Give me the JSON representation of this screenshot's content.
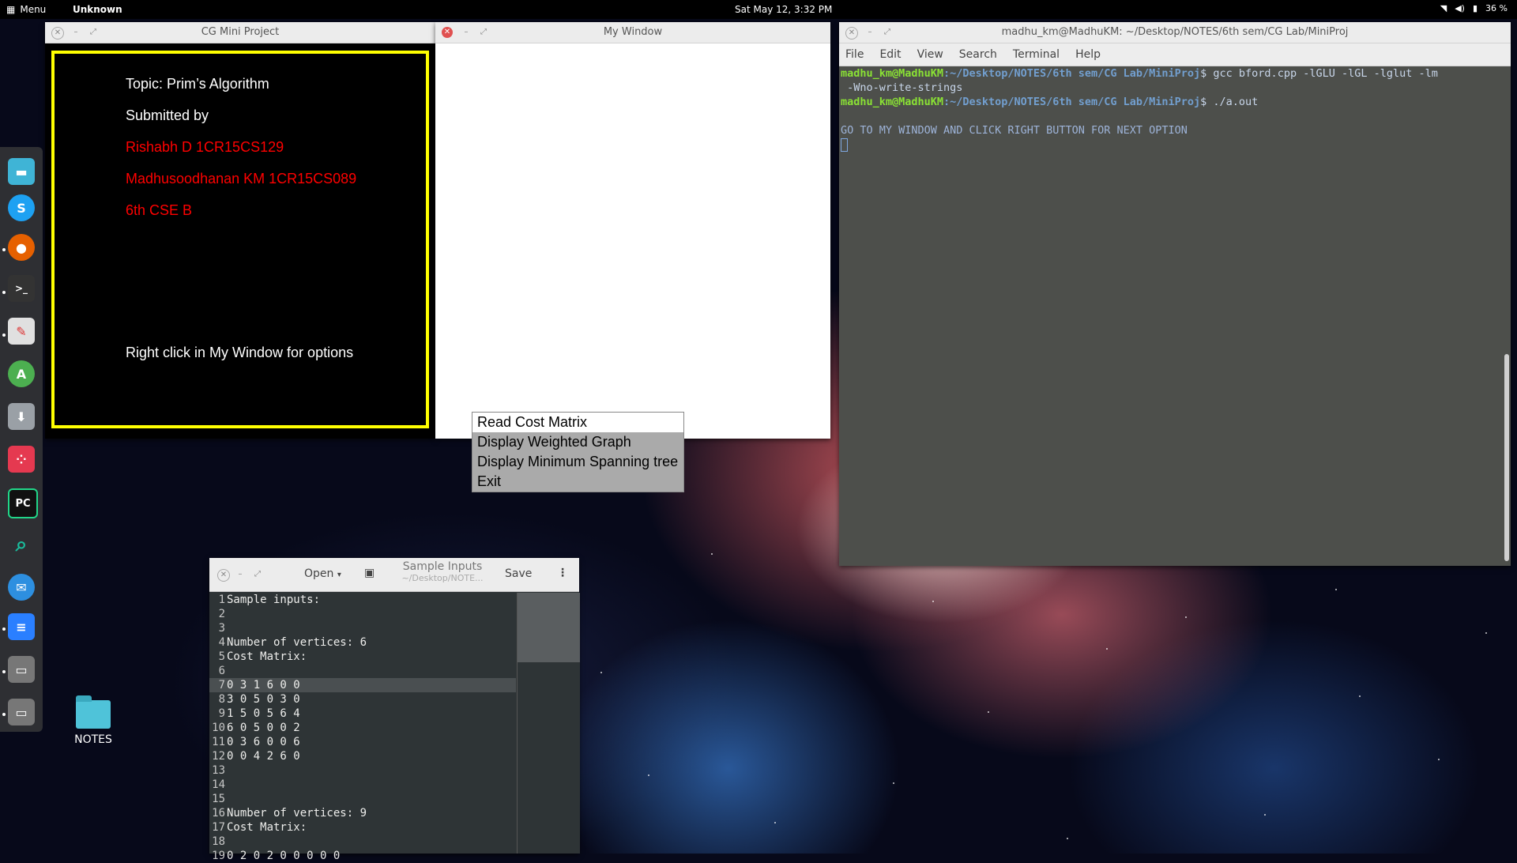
{
  "topbar": {
    "menu_label": "Menu",
    "app_label": "Unknown",
    "clock": "Sat May 12,  3:32 PM",
    "battery": "36 %"
  },
  "dock": {
    "items": [
      {
        "icon": "files-icon",
        "color": "#3fb4d6"
      },
      {
        "icon": "skype-icon",
        "color": "#1da1f2"
      },
      {
        "icon": "firefox-icon",
        "color": "#e66000"
      },
      {
        "icon": "terminal-icon",
        "color": "#333333"
      },
      {
        "icon": "text-editor-icon",
        "color": "#e0e0e0"
      },
      {
        "icon": "android-studio-icon",
        "color": "#4caf50"
      },
      {
        "icon": "software-center-icon",
        "color": "#9aa0a6"
      },
      {
        "icon": "app-icon",
        "color": "#e53950"
      },
      {
        "icon": "pycharm-icon",
        "color": "#21d789"
      },
      {
        "icon": "search-icon",
        "color": "#1abc9c"
      },
      {
        "icon": "thunderbird-icon",
        "color": "#2d8fe0"
      },
      {
        "icon": "document-icon",
        "color": "#2a7fff"
      },
      {
        "icon": "window-icon",
        "color": "#9a9a9a"
      },
      {
        "icon": "window-icon-2",
        "color": "#9a9a9a"
      }
    ]
  },
  "cg_window": {
    "title": "CG Mini Project",
    "topic": "Topic: Prim’s Algorithm",
    "submitted_by": "Submitted by",
    "student1": "Rishabh D  1CR15CS129",
    "student2": "Madhusoodhanan KM  1CR15CS089",
    "class": "6th CSE B",
    "hint": "Right click in My Window for options",
    "border_color": "#ffff00",
    "name_color": "#ff0000"
  },
  "my_window": {
    "title": "My Window"
  },
  "context_menu": {
    "items": [
      "Read Cost Matrix",
      "Display Weighted Graph",
      "Display Minimum Spanning tree",
      "Exit"
    ]
  },
  "terminal": {
    "title": "madhu_km@MadhuKM: ~/Desktop/NOTES/6th sem/CG Lab/MiniProj",
    "menu": [
      "File",
      "Edit",
      "View",
      "Search",
      "Terminal",
      "Help"
    ],
    "prompt_user": "madhu_km@MadhuKM",
    "prompt_path": ":~/Desktop/NOTES/6th sem/CG Lab/MiniProj",
    "cmd1": "$ gcc bford.cpp -lGLU -lGL -lglut -lm",
    "cmd1_cont": " -Wno-write-strings",
    "cmd2": "$ ./a.out",
    "message": "GO TO MY WINDOW AND CLICK RIGHT BUTTON FOR NEXT OPTION"
  },
  "gedit": {
    "open_label": "Open",
    "title": "Sample Inputs",
    "subtitle": "~/Desktop/NOTE...",
    "save_label": "Save",
    "lines": [
      {
        "n": "1",
        "t": "Sample inputs:"
      },
      {
        "n": "2",
        "t": ""
      },
      {
        "n": "3",
        "t": ""
      },
      {
        "n": "4",
        "t": "Number of vertices: 6"
      },
      {
        "n": "5",
        "t": "Cost Matrix:"
      },
      {
        "n": "6",
        "t": ""
      },
      {
        "n": "7",
        "t": "0 3 1 6 0 0"
      },
      {
        "n": "8",
        "t": "3 0 5 0 3 0"
      },
      {
        "n": "9",
        "t": "1 5 0 5 6 4"
      },
      {
        "n": "10",
        "t": "6 0 5 0 0 2"
      },
      {
        "n": "11",
        "t": "0 3 6 0 0 6"
      },
      {
        "n": "12",
        "t": "0 0 4 2 6 0"
      },
      {
        "n": "13",
        "t": ""
      },
      {
        "n": "14",
        "t": ""
      },
      {
        "n": "15",
        "t": ""
      },
      {
        "n": "16",
        "t": "Number of vertices: 9"
      },
      {
        "n": "17",
        "t": "Cost Matrix:"
      },
      {
        "n": "18",
        "t": ""
      },
      {
        "n": "19",
        "t": "0 2 0 2 0 0 0 0 0"
      }
    ]
  },
  "desktop": {
    "folder_label": "NOTES"
  }
}
